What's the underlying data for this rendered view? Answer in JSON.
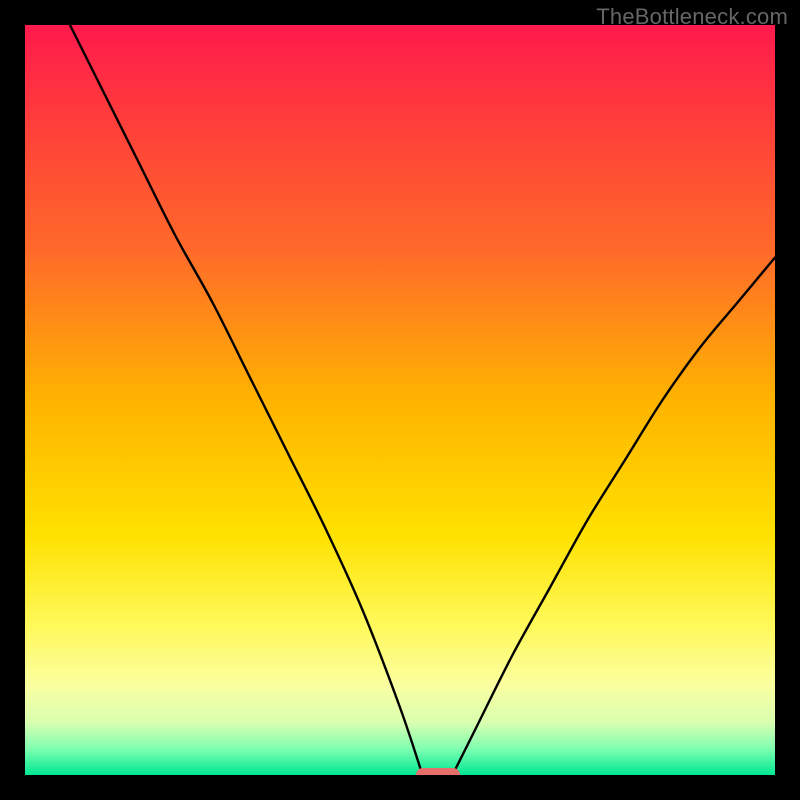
{
  "watermark": {
    "text": "TheBottleneck.com"
  },
  "colors": {
    "frame": "#000000",
    "watermark": "#666666",
    "curve": "#000000",
    "marker": "#e76f6b",
    "gradient_stops": [
      {
        "offset": 0.0,
        "color": "#ff1a4d"
      },
      {
        "offset": 0.12,
        "color": "#ff3b3b"
      },
      {
        "offset": 0.3,
        "color": "#ff6a2a"
      },
      {
        "offset": 0.5,
        "color": "#ffb300"
      },
      {
        "offset": 0.68,
        "color": "#ffe100"
      },
      {
        "offset": 0.8,
        "color": "#fff95a"
      },
      {
        "offset": 0.88,
        "color": "#fbffa0"
      },
      {
        "offset": 0.93,
        "color": "#d9ffb0"
      },
      {
        "offset": 0.965,
        "color": "#7fffb0"
      },
      {
        "offset": 1.0,
        "color": "#00e792"
      }
    ]
  },
  "chart_data": {
    "type": "line",
    "title": "",
    "xlabel": "",
    "ylabel": "",
    "xlim": [
      0,
      100
    ],
    "ylim": [
      0,
      100
    ],
    "grid": false,
    "legend": false,
    "series": [
      {
        "name": "left-branch",
        "x": [
          6,
          10,
          15,
          20,
          25,
          30,
          35,
          40,
          45,
          50,
          53
        ],
        "y": [
          100,
          92,
          82,
          72,
          63,
          53,
          43,
          33,
          22,
          9,
          0
        ]
      },
      {
        "name": "right-branch",
        "x": [
          57,
          60,
          65,
          70,
          75,
          80,
          85,
          90,
          95,
          100
        ],
        "y": [
          0,
          6,
          16,
          25,
          34,
          42,
          50,
          57,
          63,
          69
        ]
      }
    ],
    "marker": {
      "x": 55,
      "y": 0,
      "shape": "pill",
      "color": "#e76f6b"
    }
  }
}
